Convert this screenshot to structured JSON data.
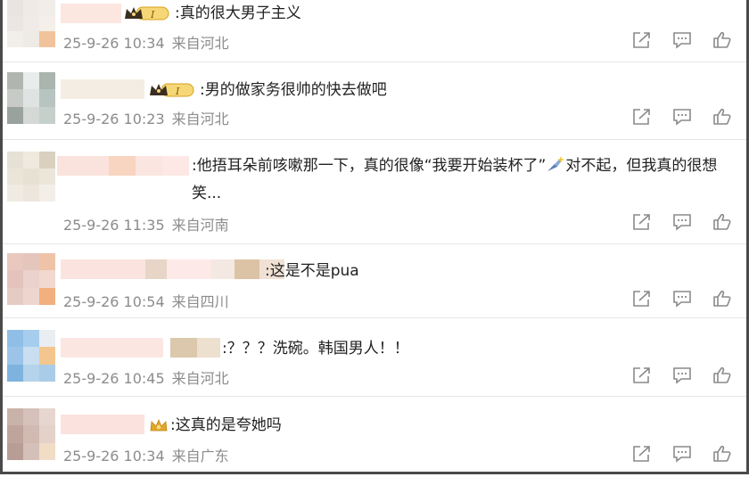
{
  "comments": [
    {
      "text": ":真的很大男子主义",
      "time": "25-9-26 10:34",
      "location": "来自河北",
      "badge": "crown-level"
    },
    {
      "text": ":男的做家务很帅的快去做吧",
      "time": "25-9-26 10:23",
      "location": "来自河北",
      "badge": "crown-level"
    },
    {
      "text": ":他捂耳朵前咳嗽那一下，真的很像“我要开始装杯了”",
      "text_tail": "对不起，但我真的很想笑...",
      "emoji": "sparkle-icon",
      "time": "25-9-26 11:35",
      "location": "来自河南"
    },
    {
      "text": ":这是不是pua",
      "time": "25-9-26 10:54",
      "location": "来自四川"
    },
    {
      "text": ":？？？洗碗。韩国男人！！",
      "time": "25-9-26 10:45",
      "location": "来自河北"
    },
    {
      "text": ":这真的是夸她吗",
      "time": "25-9-26 10:34",
      "location": "来自广东",
      "badge": "small-crown"
    }
  ],
  "icons": {
    "share": "share-icon",
    "comment": "comment-icon",
    "like": "like-icon"
  },
  "colors": {
    "meta_text": "#8c8c8c",
    "icon": "#8a8a8a",
    "badge_gold": "#d9a21b",
    "frame": "#4a4a4a"
  }
}
